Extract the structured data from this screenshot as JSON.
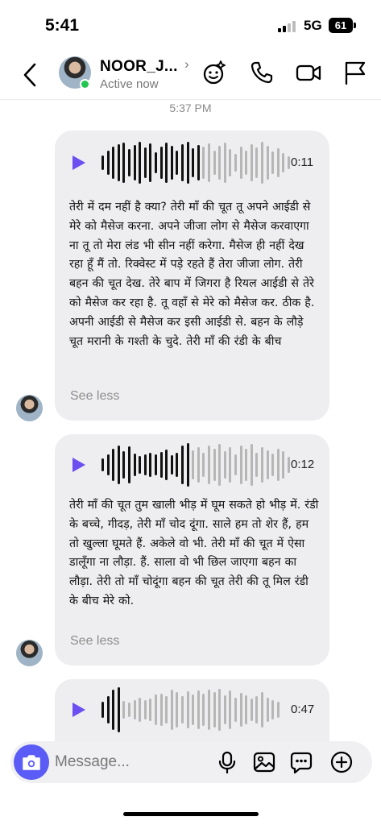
{
  "status_bar": {
    "time": "5:41",
    "network": "5G",
    "battery": "61"
  },
  "header": {
    "contact_name": "NOOR_J...",
    "chevron": "›",
    "active_status": "Active now",
    "icons": [
      "back-icon",
      "effects-icon",
      "phone-icon",
      "video-icon",
      "flag-icon"
    ]
  },
  "conversation": {
    "timestamp": "5:37 PM",
    "messages": [
      {
        "duration": "0:11",
        "text": "तेरी में दम नहीं है क्या? तेरी माँ की चूत तू अपने आईडी से मेरे को मैसेज करना. अपने जीजा लोग से मैसेज करवाएगा ना तू तो मेरा लंड भी सीन नहीं करेगा. मैसेज ही नहीं देख रहा हूँ मैं तो. रिक्वेस्ट में पड़े रहते हैं तेरा जीजा लोग. तेरी बहन की चूत देख. तेरे बाप में जिगरा है रियल आईडी से तेरे को मैसेज कर रहा है. तू वहाँ से मेरे को मैसेज कर. ठीक है. अपनी आईडी से मैसेज कर इसी आईडी से. बहन के लौड़े चूत मरानी के गश्ती के चुदे. तेरी माँ की रंडी के बीच",
        "see_less": "See less"
      },
      {
        "duration": "0:12",
        "text": "तेरी माँ की चूत तुम खाली भीड़ में घूम सकते हो भीड़ में. रंडी के बच्चे, गीदड़, तेरी माँ चोद दूंगा. साले हम तो शेर हैं, हम तो खुल्ला घूमते हैं. अकेले वो भी. तेरी माँ की चूत में ऐसा डालूँगा ना लौड़ा. हैं. साला वो भी छिल जाएगा बहन का लौड़ा. तेरी तो माँ चोदूंगा बहन की चूत तेरी की तू मिल रंडी के बीच मेरे को.",
        "see_less": "See less"
      },
      {
        "duration": "0:47"
      }
    ]
  },
  "composer": {
    "placeholder": "Message...",
    "icons": [
      "camera-icon",
      "microphone-icon",
      "image-icon",
      "sticker-icon",
      "plus-icon"
    ]
  },
  "colors": {
    "accent": "#6b4ff0",
    "bubble": "#eeeef0",
    "active": "#23c552",
    "camera_button": "#5b5bf6"
  }
}
